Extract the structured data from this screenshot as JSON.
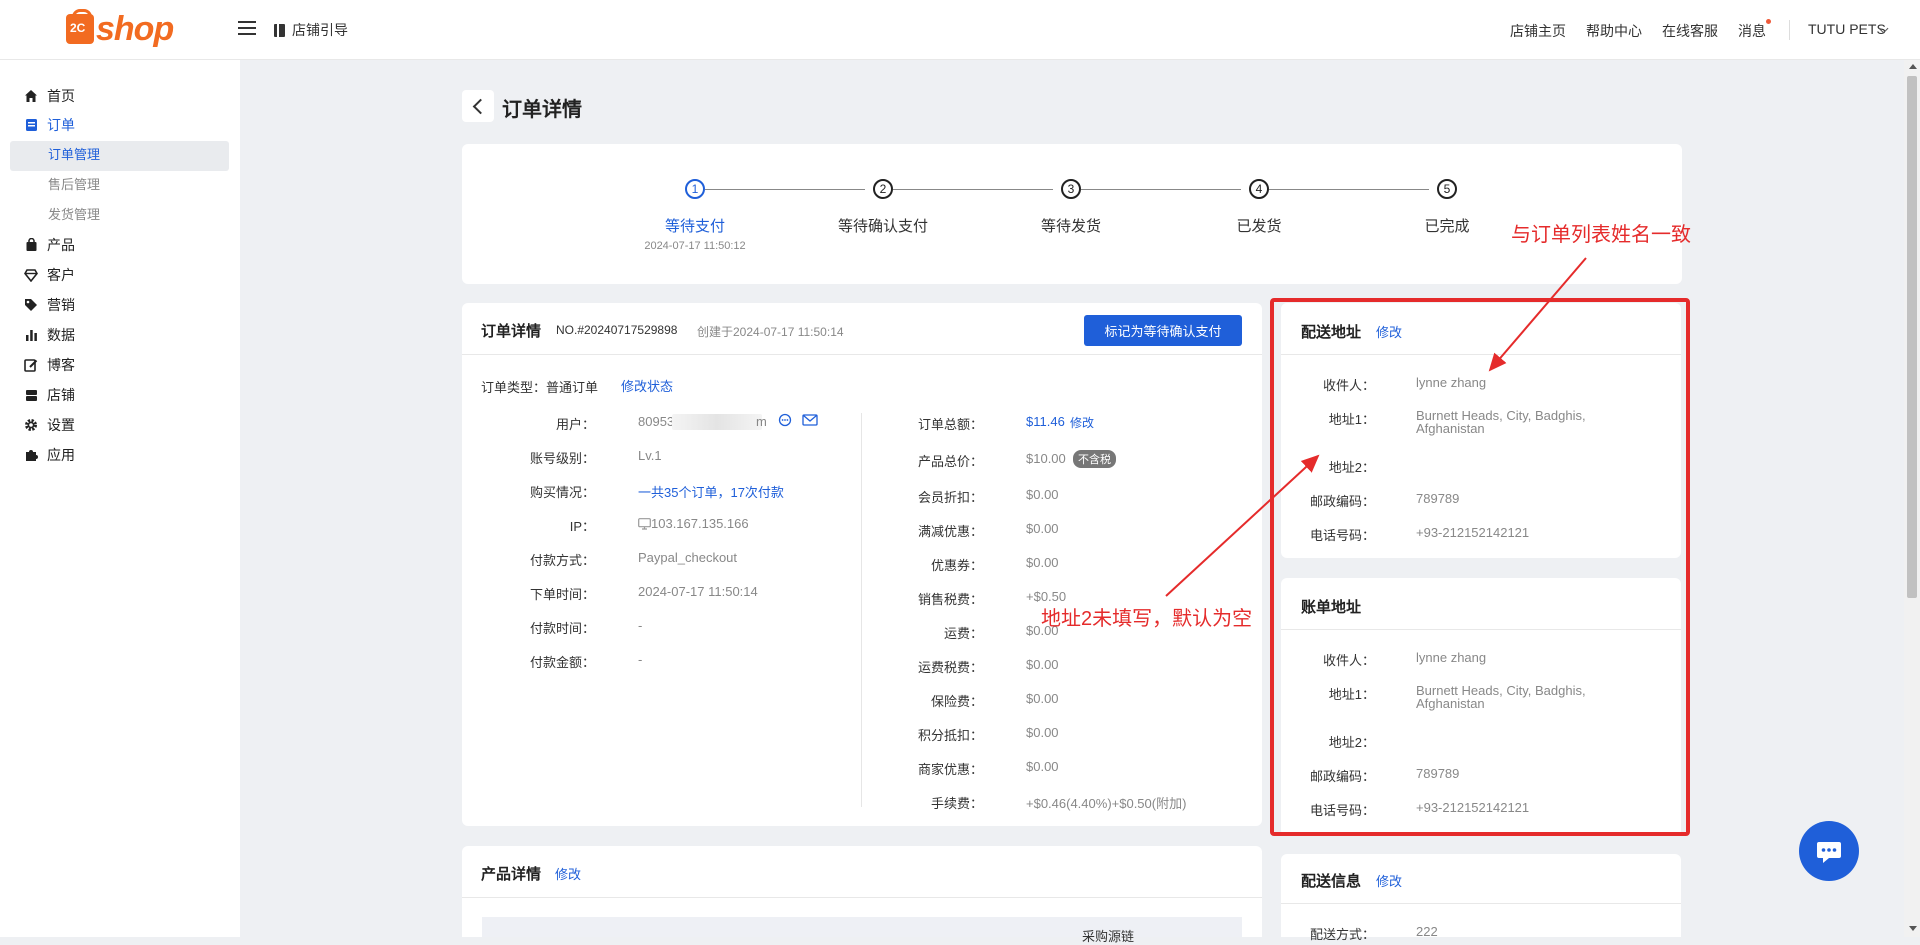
{
  "app": {
    "logo_prefix": "2C",
    "logo_word": "shop"
  },
  "header": {
    "guide_label": "店铺引导",
    "links": [
      "店铺主页",
      "帮助中心",
      "在线客服",
      "消息"
    ],
    "store_name": "TUTU PETS"
  },
  "sidebar": {
    "items": [
      {
        "label": "首页",
        "icon": "home-icon"
      },
      {
        "label": "订单",
        "icon": "order-icon"
      },
      {
        "label": "产品",
        "icon": "bag-icon"
      },
      {
        "label": "客户",
        "icon": "diamond-icon"
      },
      {
        "label": "营销",
        "icon": "tag-icon"
      },
      {
        "label": "数据",
        "icon": "chart-icon"
      },
      {
        "label": "博客",
        "icon": "edit-icon"
      },
      {
        "label": "店铺",
        "icon": "store-icon"
      },
      {
        "label": "设置",
        "icon": "gear-icon"
      },
      {
        "label": "应用",
        "icon": "puzzle-icon"
      }
    ],
    "order_sub": [
      "订单管理",
      "售后管理",
      "发货管理"
    ]
  },
  "page": {
    "title": "订单详情"
  },
  "steps": [
    {
      "num": "1",
      "label": "等待支付",
      "time": "2024-07-17 11:50:12"
    },
    {
      "num": "2",
      "label": "等待确认支付"
    },
    {
      "num": "3",
      "label": "等待发货"
    },
    {
      "num": "4",
      "label": "已发货"
    },
    {
      "num": "5",
      "label": "已完成"
    }
  ],
  "order": {
    "title": "订单详情",
    "number": "NO.#20240717529898",
    "created": "创建于2024-07-17 11:50:14",
    "mark_button": "标记为等待确认支付",
    "type_label": "订单类型：普通订单",
    "modify_status": "修改状态",
    "left_rows": [
      {
        "label": "用户：",
        "value": "80953"
      },
      {
        "label": "账号级别：",
        "value": "Lv.1"
      },
      {
        "label": "购买情况：",
        "value": "一共35个订单，17次付款"
      },
      {
        "label": "IP：",
        "value": "103.167.135.166"
      },
      {
        "label": "付款方式：",
        "value": "Paypal_checkout"
      },
      {
        "label": "下单时间：",
        "value": "2024-07-17 11:50:14"
      },
      {
        "label": "付款时间：",
        "value": "-"
      },
      {
        "label": "付款金额：",
        "value": "-"
      }
    ],
    "user_suffix": "m",
    "right_rows": [
      {
        "label": "订单总额：",
        "value": "$11.46"
      },
      {
        "label": "产品总价：",
        "value": "$10.00"
      },
      {
        "label": "会员折扣：",
        "value": "$0.00"
      },
      {
        "label": "满减优惠：",
        "value": "$0.00"
      },
      {
        "label": "优惠券：",
        "value": "$0.00"
      },
      {
        "label": "销售税费：",
        "value": "+$0.50"
      },
      {
        "label": "运费：",
        "value": "$0.00"
      },
      {
        "label": "运费税费：",
        "value": "$0.00"
      },
      {
        "label": "保险费：",
        "value": "$0.00"
      },
      {
        "label": "积分抵扣：",
        "value": "$0.00"
      },
      {
        "label": "商家优惠：",
        "value": "$0.00"
      },
      {
        "label": "手续费：",
        "value": "+$0.46(4.40%)+$0.50(附加)"
      }
    ],
    "total_modify": "修改",
    "tax_badge": "不含税"
  },
  "product": {
    "title": "产品详情",
    "modify": "修改",
    "col_header": "采购源链"
  },
  "shipping_address": {
    "title": "配送地址",
    "modify": "修改",
    "rows": [
      {
        "label": "收件人：",
        "value": "lynne zhang"
      },
      {
        "label": "地址1：",
        "value": "Burnett Heads, City, Badghis, Afghanistan"
      },
      {
        "label": "地址2：",
        "value": ""
      },
      {
        "label": "邮政编码：",
        "value": "789789"
      },
      {
        "label": "电话号码：",
        "value": "+93-212152142121"
      }
    ]
  },
  "billing_address": {
    "title": "账单地址",
    "rows": [
      {
        "label": "收件人：",
        "value": "lynne zhang"
      },
      {
        "label": "地址1：",
        "value": "Burnett Heads, City, Badghis, Afghanistan"
      },
      {
        "label": "地址2：",
        "value": ""
      },
      {
        "label": "邮政编码：",
        "value": "789789"
      },
      {
        "label": "电话号码：",
        "value": "+93-212152142121"
      }
    ]
  },
  "delivery_info": {
    "title": "配送信息",
    "modify": "修改",
    "method_label": "配送方式：",
    "method_value": "222"
  },
  "annotations": {
    "name_note": "与订单列表姓名一致",
    "address2_note": "地址2未填写，默认为空"
  },
  "colors": {
    "primary": "#1f5fd9",
    "brand": "#f26b21",
    "annotation": "#e52b2b"
  }
}
